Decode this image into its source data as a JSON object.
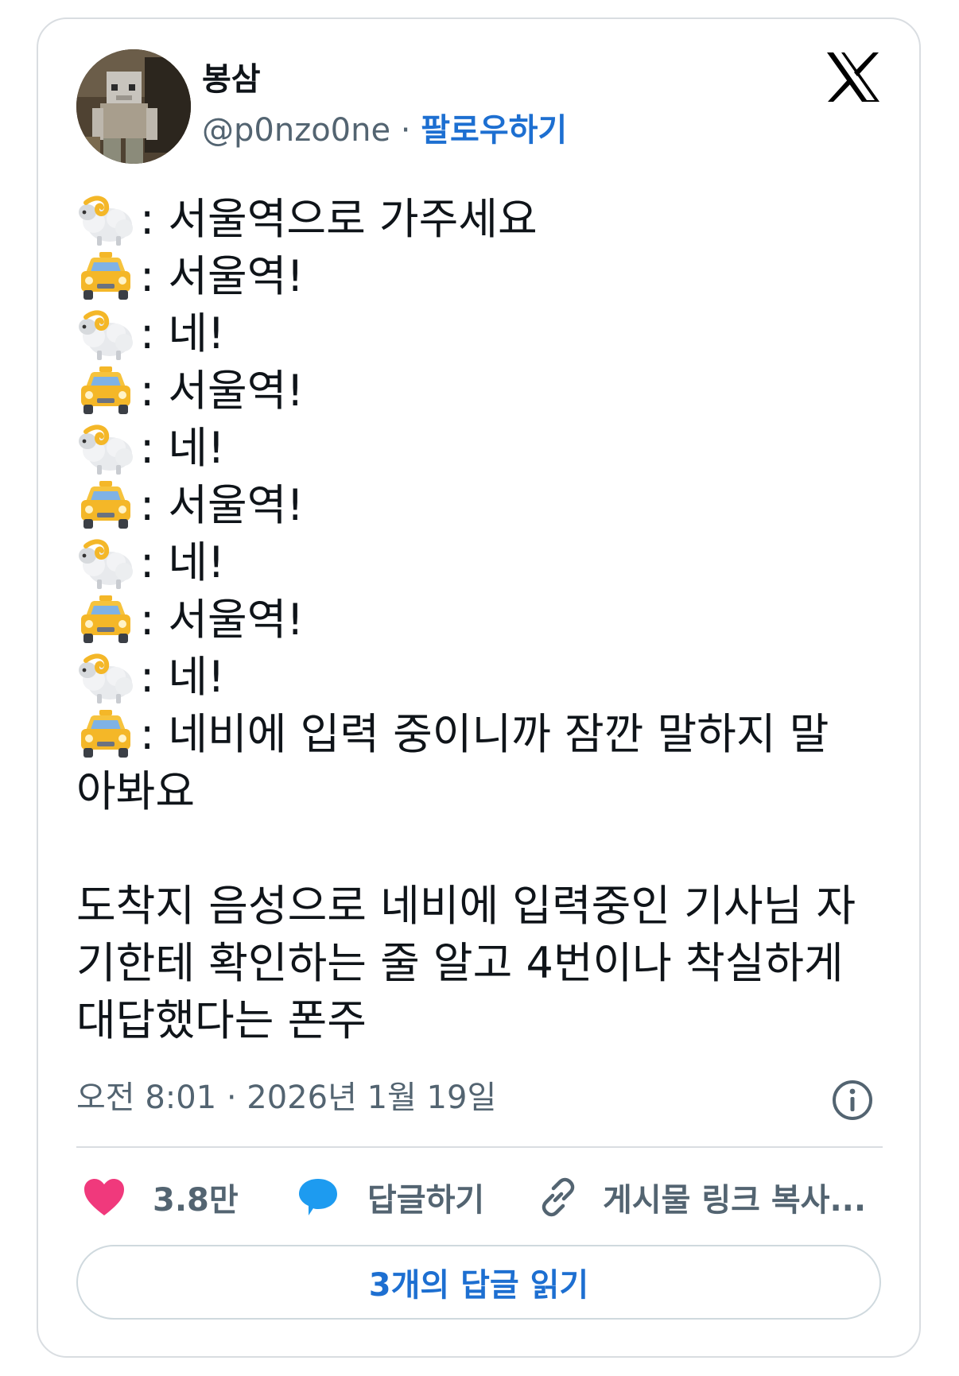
{
  "user": {
    "display_name": "봉삼",
    "handle": "@p0nzo0ne",
    "separator": "·",
    "follow_label": "팔로우하기"
  },
  "icons": {
    "logo": "x-logo-icon",
    "speaker_a": "ram-icon",
    "speaker_b": "taxi-icon",
    "info": "info-icon",
    "like": "heart-icon",
    "reply": "speech-bubble-icon",
    "link": "link-icon"
  },
  "tweet": {
    "dialogue": [
      {
        "speaker": "ram",
        "text": ": 서울역으로 가주세요"
      },
      {
        "speaker": "taxi",
        "text": ": 서울역!"
      },
      {
        "speaker": "ram",
        "text": ": 네!"
      },
      {
        "speaker": "taxi",
        "text": ": 서울역!"
      },
      {
        "speaker": "ram",
        "text": ": 네!"
      },
      {
        "speaker": "taxi",
        "text": ": 서울역!"
      },
      {
        "speaker": "ram",
        "text": ": 네!"
      },
      {
        "speaker": "taxi",
        "text": ": 서울역!"
      },
      {
        "speaker": "ram",
        "text": ": 네!"
      },
      {
        "speaker": "taxi",
        "text": ": 네비에 입력 중이니까 잠깐 말하지 말"
      }
    ],
    "dialogue_wrap": "아봐요",
    "explanation_lines": [
      "도착지 음성으로 네비에 입력중인 기사님 자",
      "기한테 확인하는 줄 알고 4번이나 착실하게",
      "대답했다는 폰주"
    ]
  },
  "timestamp": "오전 8:01 · 2026년 1월 19일",
  "actions": {
    "like_count": "3.8만",
    "reply_label": "답글하기",
    "copy_link_label": "게시물 링크 복사..."
  },
  "read_replies_label": "3개의 답글 읽기",
  "colors": {
    "accent": "#1d6fd1",
    "like": "#f0397c",
    "reply": "#1d9bf0",
    "muted_text": "#536471",
    "border": "#d9dde1"
  }
}
